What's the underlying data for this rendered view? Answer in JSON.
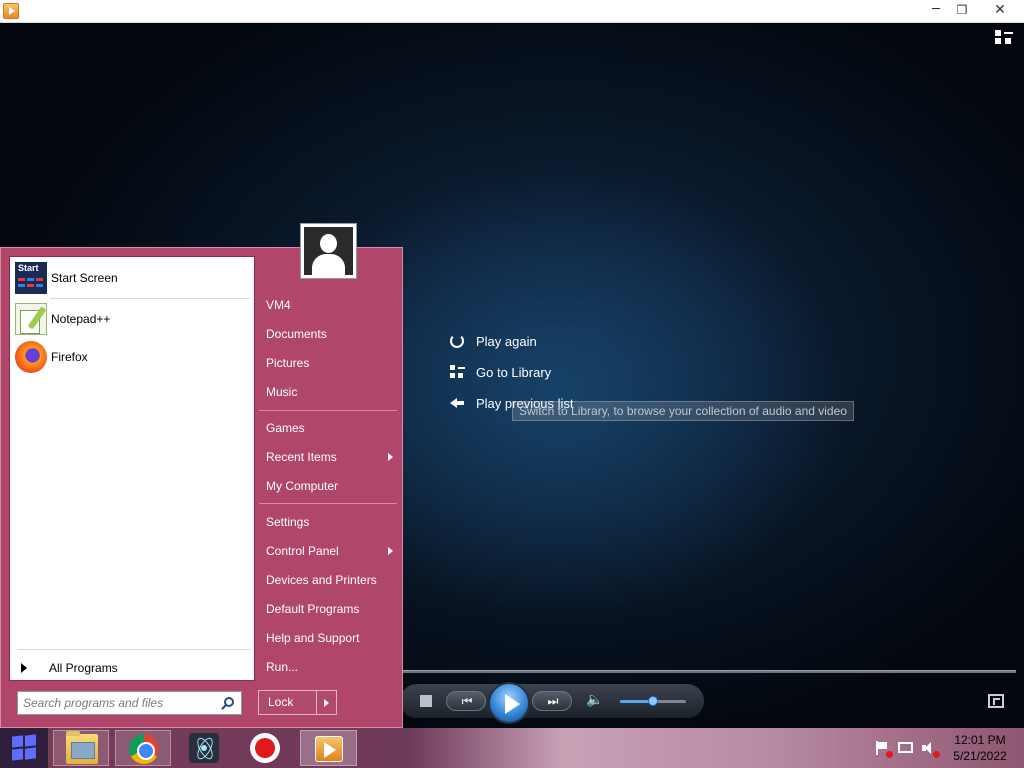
{
  "window": {
    "minimize_glyph": "─",
    "restore_glyph": "❐",
    "close_glyph": "✕"
  },
  "player": {
    "switch_view_icon": "switch-to-library-icon",
    "options": [
      {
        "label": "Play again",
        "icon": "play-again-icon"
      },
      {
        "label": "Go to Library",
        "icon": "library-icon"
      },
      {
        "label": "Play previous list",
        "icon": "back-arrow-icon"
      }
    ],
    "tooltip": "Switch to Library, to browse your collection of audio and video",
    "controls": {
      "prev_glyph": "⏮",
      "next_glyph": "⏭",
      "volume_glyph": "🔈",
      "volume_level": 0.5
    }
  },
  "start_menu": {
    "pinned": [
      {
        "label": "Start Screen",
        "tile_text": "Start"
      },
      {
        "label": "Notepad++"
      },
      {
        "label": "Firefox"
      }
    ],
    "all_programs": "All Programs",
    "search_placeholder": "Search programs and files",
    "right_items": [
      {
        "label": "VM4",
        "submenu": false
      },
      {
        "label": "Documents",
        "submenu": false
      },
      {
        "label": "Pictures",
        "submenu": false
      },
      {
        "label": "Music",
        "submenu": false
      },
      {
        "label": "Games",
        "submenu": false
      },
      {
        "label": "Recent Items",
        "submenu": true
      },
      {
        "label": "My Computer",
        "submenu": false
      },
      {
        "label": "Settings",
        "submenu": false
      },
      {
        "label": "Control Panel",
        "submenu": true
      },
      {
        "label": "Devices and Printers",
        "submenu": false
      },
      {
        "label": "Default Programs",
        "submenu": false
      },
      {
        "label": "Help and Support",
        "submenu": false
      },
      {
        "label": "Run...",
        "submenu": false
      }
    ],
    "lock_label": "Lock"
  },
  "taskbar": {
    "apps": [
      "File Explorer",
      "Google Chrome",
      "Electron",
      "Screen Recorder",
      "Media Player"
    ],
    "clock_time": "12:01 PM",
    "clock_date": "5/21/2022"
  },
  "colors": {
    "start_menu_accent": "#b0466a",
    "taskbar_accent": "#7a3b58",
    "player_play_button": "#2f7fd2"
  }
}
